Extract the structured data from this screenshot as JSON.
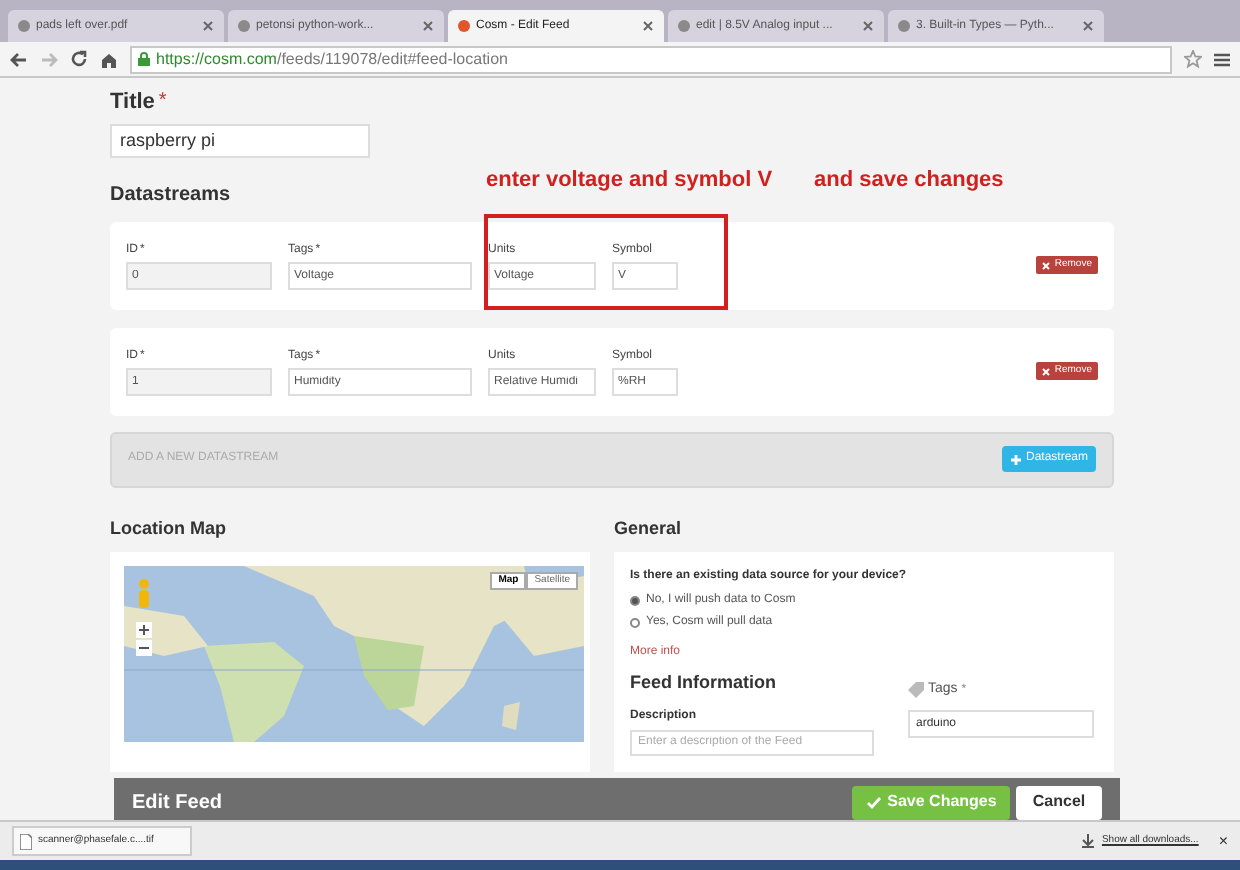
{
  "browser": {
    "tabs": [
      {
        "title": "pads left over.pdf",
        "selected": false
      },
      {
        "title": "petonsi python-work...",
        "selected": false
      },
      {
        "title": "Cosm - Edit Feed",
        "selected": true
      },
      {
        "title": "edit | 8.5V Analog input ...",
        "selected": false
      },
      {
        "title": "3. Built-in Types — Pyth...",
        "selected": false
      }
    ],
    "url_host": "https://cosm.com",
    "url_path": "/feeds/119078/edit#feed-location"
  },
  "title_field": {
    "label": "Title",
    "required_mark": "*",
    "value": "raspberry pi"
  },
  "annotations": [
    "enter voltage and symbol V",
    "and save changes"
  ],
  "datastreams": {
    "heading": "Datastreams",
    "rows": [
      {
        "labels": [
          {
            "text": "ID",
            "required_mark": "*"
          },
          {
            "text": "Tags",
            "required_mark": "*"
          },
          {
            "text": "Units"
          },
          {
            "text": "Symbol"
          }
        ],
        "id": "0",
        "tags": "Voltage",
        "units": "Voltage",
        "symbol": "V",
        "highlighted": true,
        "remove_label": "Remove"
      },
      {
        "labels": [
          {
            "text": "ID",
            "required_mark": "*"
          },
          {
            "text": "Tags",
            "required_mark": "*"
          },
          {
            "text": "Units"
          },
          {
            "text": "Symbol"
          }
        ],
        "id": "1",
        "tags": "Humidity",
        "units": "Relative Humidi",
        "symbol": "%RH",
        "highlighted": false,
        "remove_label": "Remove"
      }
    ],
    "add_hint": "ADD A NEW DATASTREAM",
    "add_button": "Datastream"
  },
  "location_map": {
    "heading": "Location Map",
    "map_type_buttons": [
      {
        "label": "Map",
        "selected": true
      },
      {
        "label": "Satellite",
        "selected": false
      }
    ]
  },
  "general": {
    "heading": "General",
    "question": "Is there an existing data source for your device?",
    "options": [
      {
        "label": "No, I will push data to Cosm",
        "selected": true
      },
      {
        "label": "Yes, Cosm will pull data",
        "selected": false
      }
    ],
    "more_info": "More info",
    "feed_information": "Feed Information",
    "description_label": "Description",
    "description_placeholder": "Enter a description of the Feed",
    "tags_label": "Tags",
    "tags_required_mark": "*",
    "tags_value": "arduino"
  },
  "action_bar": {
    "title": "Edit Feed",
    "save": "Save Changes",
    "cancel": "Cancel"
  },
  "download_bar": {
    "file": "scanner@phasefale.c....tif",
    "show_all": "Show all downloads...",
    "close": "×"
  }
}
